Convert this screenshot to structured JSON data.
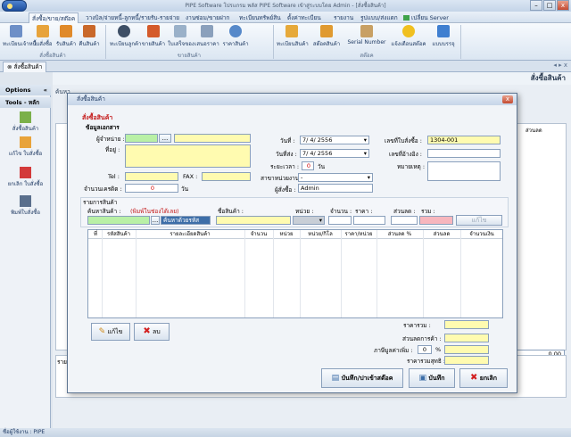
{
  "window": {
    "title": "PIPE Software โปรแกรม พลัส PIPE Software เข้าสู่ระบบโดย Admin - [สั่งซื้อสินค้า]",
    "min": "–",
    "max": "□",
    "close": "x"
  },
  "menu": {
    "tabs": [
      "สั่งซื้อ/ขาย/สต๊อค",
      "วางบิล/จ่ายหนี้-ลูกหนี้/รายรับ-รายจ่าย",
      "งานซ่อม/ขายฝาก",
      "ทะเบียนทรัพย์สิน",
      "ตั้งค่าทะเบียน",
      "รายงาน",
      "รูปแบบ/ส่งแดก",
      "เปลี่ยน Server"
    ]
  },
  "ribbon": {
    "buttons": [
      {
        "label": "ทะเบียนเจ้าหนี้",
        "color": "#6d8fc7"
      },
      {
        "label": "ใบสั่งซื้อ",
        "color": "#e7a33b"
      },
      {
        "label": "รับสินค้า",
        "color": "#e08a2a"
      },
      {
        "label": "คืนสินค้า",
        "color": "#c9682a"
      },
      {
        "label": "ทะเบียนลูกค้า",
        "color": "#3e4f66"
      },
      {
        "label": "ขายสินค้า",
        "color": "#d45a2a"
      },
      {
        "label": "ใบเสร็จของ",
        "color": "#9ab1c9"
      },
      {
        "label": "เสนอราคา",
        "color": "#8aa0bc"
      },
      {
        "label": "ราคาสินค้า",
        "color": "#5588c9"
      },
      {
        "label": "ทะเบียนสินค้า",
        "color": "#e6a93a"
      },
      {
        "label": "สต๊อคสินค้า",
        "color": "#e09a30"
      },
      {
        "label": "Serial Number",
        "color": "#c8a064"
      },
      {
        "label": "แจ้งเตือนสต๊อค",
        "color": "#f0c020"
      },
      {
        "label": "แบบบรรจุ",
        "color": "#3f7fd0"
      }
    ],
    "groups": [
      "สั่งซื้อสินค้า",
      "ขายสินค้า",
      "สต๊อค"
    ]
  },
  "doc_tab": "สั่งซื้อสินค้า",
  "background": {
    "header": "สั่งซื้อสินค้า",
    "search_label": "ค้นหา",
    "col_header": "ส่วนลด",
    "total_value": "0.00",
    "bottom_label": "รายล"
  },
  "left_panel": {
    "options": "Options",
    "tools": "Tools - หลัก",
    "buttons": [
      {
        "label": "สั่งซื้อสินค้า",
        "color": "#7bb04a"
      },
      {
        "label": "แก้ไข ใบสั่งซื้อ",
        "color": "#e8a33a"
      },
      {
        "label": "ยกเลิก ใบสั่งซื้อ",
        "color": "#d33a3a"
      },
      {
        "label": "พิมพ์ใบสั่งซื้อ",
        "color": "#5a6f8c"
      }
    ]
  },
  "dialog": {
    "title": "สั่งซื้อสินค้า",
    "heading": "สั่งซื้อสินค้า",
    "doc_section": "ข้อมูลเอกสาร",
    "supplier_label": "ผู้จำหน่าย :",
    "address_label": "ที่อยู่ :",
    "tel_label": "Tel :",
    "fax_label": "FAX :",
    "credit_label": "จำนวนเครดิต :",
    "credit_value": "0",
    "credit_unit": "วัน",
    "browse": "...",
    "date_label": "วันที่ :",
    "date_value": "7/ 4/ 2556",
    "due_label": "วันที่ส่ง :",
    "due_value": "7/ 4/ 2556",
    "period_label": "ระยะเวลา :",
    "period_value": "0",
    "period_unit": "วัน",
    "branch_label": "สาขาหน่วยงาน :",
    "branch_value": "-",
    "orderer_label": "ผู้สั่งซื้อ :",
    "orderer_value": "Admin",
    "po_label": "เลขที่ใบสั่งซื้อ :",
    "po_value": "1304-001",
    "ref_label": "เลขที่อ้างอิง :",
    "note_label": "หมายเหตุ :",
    "items_section": "รายการสินค้า",
    "search_product_label": "ค้นหาสินค้า :",
    "search_hint": "(พิมพ์ในช่องได้เลย)",
    "search_mode": "ค้นหาด้วยรหัส",
    "product_name_label": "ชื่อสินค้า :",
    "unit_label": "หน่วย :",
    "qty_label": "จำนวน :",
    "price_label": "ราคา :",
    "discount_label": "ส่วนลด :",
    "total_label": "รวม :",
    "edit_row_button": "แก้ไข",
    "columns": [
      "ที่",
      "รหัสสินค้า",
      "รายละเอียดสินค้า",
      "จำนวน",
      "หน่วย",
      "หน่วย/กิโล",
      "ราคา/หน่วย",
      "ส่วนลด %",
      "ส่วนลด",
      "จำนวนเงิน"
    ],
    "edit_button": "แก้ไข",
    "delete_button": "ลบ",
    "subtotal_label": "ราคารวม :",
    "bill_discount_label": "ส่วนลดการค้า :",
    "vat_label": "ภาษีมูลค่าเพิ่ม :",
    "vat_value": "0",
    "vat_unit": "%",
    "net_label": "ราคารวมสุทธิ :",
    "save_close_button": "บันทึก/ปาเข้าสต๊อค",
    "save_button": "บันทึก",
    "cancel_button": "ยกเลิก"
  },
  "status": "ชื่อผู้ใช้งาน : PIPE"
}
